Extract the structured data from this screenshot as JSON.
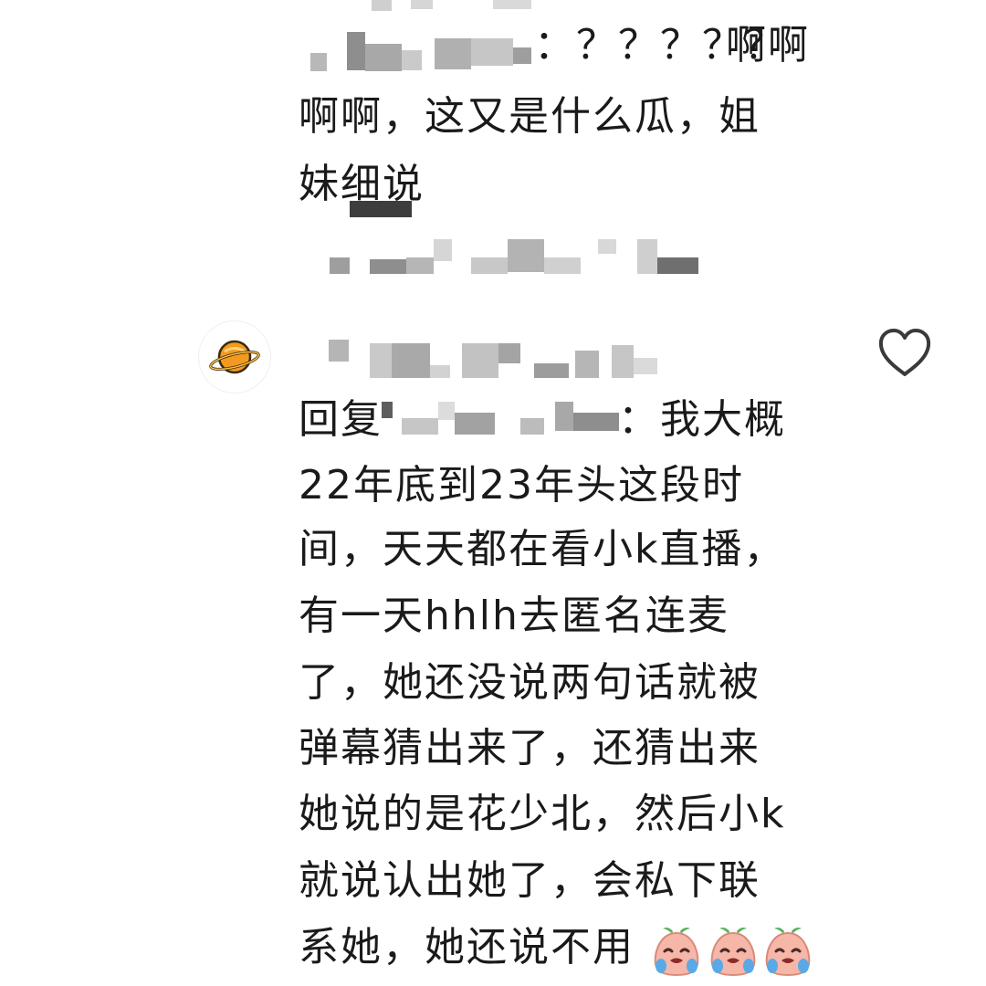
{
  "parent_comment": {
    "reply_prefix_masked": true,
    "reply_prefix_suffix": "：？？？？？",
    "lines": [
      "啊啊",
      "啊啊，这又是什么瓜，姐",
      "妹细说"
    ]
  },
  "comment": {
    "avatar_icon": "planet-icon",
    "username_masked": true,
    "like_icon": "heart-outline-icon",
    "lines": [
      "回复",
      "：我大概",
      "22年底到23年头这段时",
      "间，天天都在看小k直播，",
      "有一天hhlh去匿名连麦",
      "了，她还没说两句话就被",
      "弹幕猜出来了，还猜出来",
      "她说的是花少北，然后小k",
      "就说认出她了，会私下联",
      "系她，她还说不用"
    ],
    "trailing_emojis": [
      "crying-face-emoji",
      "crying-face-emoji",
      "crying-face-emoji"
    ]
  },
  "colors": {
    "text": "#1a1a1a",
    "icon_stroke": "#3a3a3a",
    "avatar_planet": "#f39a1e",
    "emoji_skin": "#f6b7a8",
    "emoji_tear": "#5aa9e6",
    "emoji_leaf": "#59b25c",
    "mosaic_gray": "#9a9a9a"
  }
}
